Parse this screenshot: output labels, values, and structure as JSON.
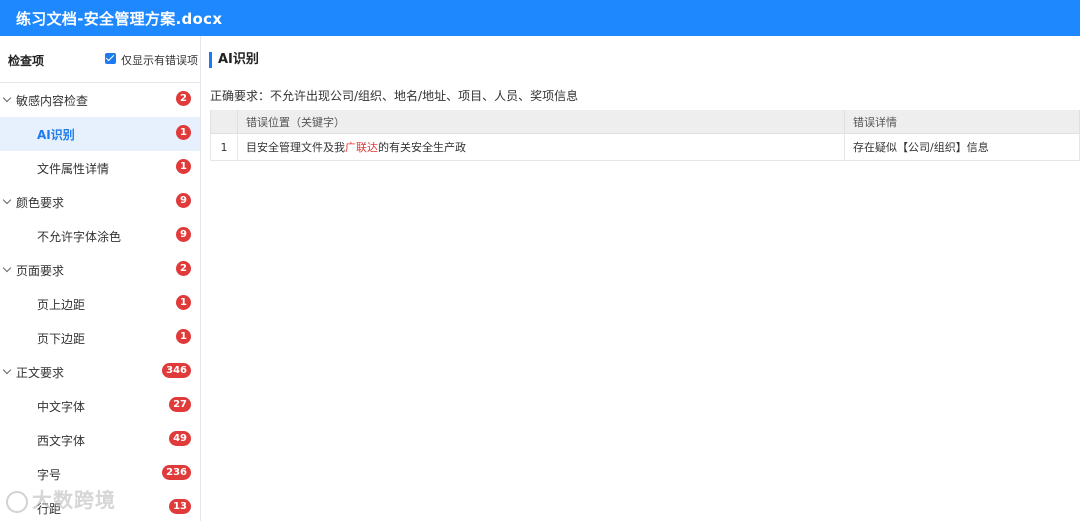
{
  "window": {
    "title": "练习文档-安全管理方案.docx"
  },
  "sidebar": {
    "header_title": "检查项",
    "filter_label": "仅显示有错误项",
    "items": [
      {
        "label": "敏感内容检查",
        "count": "2",
        "level": "parent"
      },
      {
        "label": "AI识别",
        "count": "1",
        "level": "child",
        "selected": true
      },
      {
        "label": "文件属性详情",
        "count": "1",
        "level": "child"
      },
      {
        "label": "颜色要求",
        "count": "9",
        "level": "parent"
      },
      {
        "label": "不允许字体涂色",
        "count": "9",
        "level": "child"
      },
      {
        "label": "页面要求",
        "count": "2",
        "level": "parent"
      },
      {
        "label": "页上边距",
        "count": "1",
        "level": "child"
      },
      {
        "label": "页下边距",
        "count": "1",
        "level": "child"
      },
      {
        "label": "正文要求",
        "count": "346",
        "level": "parent"
      },
      {
        "label": "中文字体",
        "count": "27",
        "level": "child"
      },
      {
        "label": "西文字体",
        "count": "49",
        "level": "child"
      },
      {
        "label": "字号",
        "count": "236",
        "level": "child"
      },
      {
        "label": "行距",
        "count": "13",
        "level": "child"
      }
    ]
  },
  "main": {
    "section_title": "AI识别",
    "requirement": "正确要求：不允许出现公司/组织、地名/地址、项目、人员、奖项信息",
    "table": {
      "columns": [
        "",
        "错误位置（关键字）",
        "错误详情"
      ],
      "rows": [
        {
          "index": "1",
          "location_before": "目安全管理文件及我",
          "location_keyword": "广联达",
          "location_after": "的有关安全生产政",
          "detail": "存在疑似【公司/组织】信息"
        }
      ]
    }
  },
  "watermark": {
    "text": "大数跨境"
  },
  "colors": {
    "accent": "#1e88ff",
    "badge": "#e03a3a",
    "selected_bg": "#e6f1fd"
  }
}
